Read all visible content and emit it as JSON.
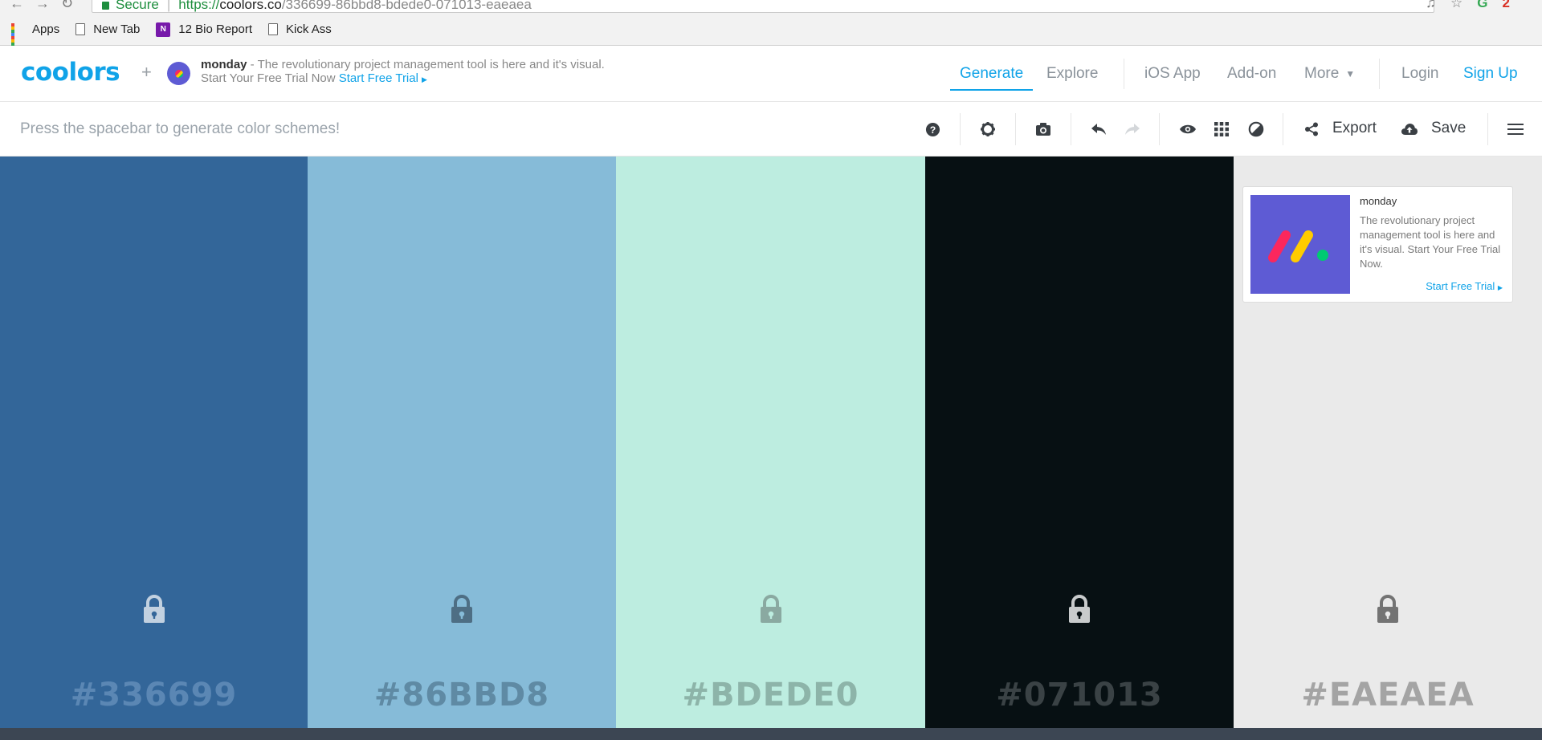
{
  "browser": {
    "secure_label": "Secure",
    "url_protocol": "https://",
    "url_host": "coolors.co",
    "url_path": "/336699-86bbd8-bdede0-071013-eaeaea",
    "bookmarks": [
      {
        "label": "Apps",
        "icon": "apps-grid-icon"
      },
      {
        "label": "New Tab",
        "icon": "page-icon"
      },
      {
        "label": "12 Bio Report",
        "icon": "onenote-icon"
      },
      {
        "label": "Kick Ass",
        "icon": "page-icon"
      }
    ],
    "extension_badge": "2"
  },
  "header": {
    "logo": "coolors",
    "plus": "+",
    "ad_brand": "monday",
    "ad_text": " - The revolutionary project management tool is here and it's visual.",
    "ad_line2": "Start Your Free Trial Now",
    "ad_cta": "Start Free Trial",
    "nav": {
      "generate": "Generate",
      "explore": "Explore",
      "ios": "iOS App",
      "addon": "Add-on",
      "more": "More",
      "login": "Login",
      "signup": "Sign Up"
    },
    "accent_color": "#10a3e8"
  },
  "toolbar": {
    "hint": "Press the spacebar to generate color schemes!",
    "export_label": "Export",
    "save_label": "Save",
    "icons": [
      "help-icon",
      "settings-icon",
      "camera-icon",
      "undo-icon",
      "redo-icon",
      "view-icon",
      "grid-icon",
      "adjust-icon",
      "share-icon",
      "cloud-upload-icon",
      "menu-icon"
    ]
  },
  "palette": {
    "swatches": [
      {
        "hex": "#336699",
        "color": "#336699",
        "hex_text_color": "#5b87b4",
        "lock_color": "#c2d1e0"
      },
      {
        "hex": "#86BBD8",
        "color": "#86bbd8",
        "hex_text_color": "#5f8aa4",
        "lock_color": "#4e6e84"
      },
      {
        "hex": "#BDEDE0",
        "color": "#bdede0",
        "hex_text_color": "#8db4a9",
        "lock_color": "#8aa9a1"
      },
      {
        "hex": "#071013",
        "color": "#071013",
        "hex_text_color": "#3a4245",
        "lock_color": "#c8cbcc"
      },
      {
        "hex": "#EAEAEA",
        "color": "#eaeaea",
        "hex_text_color": "#a4a4a4",
        "lock_color": "#737373"
      }
    ]
  },
  "sponsor_card": {
    "title": "monday",
    "description": "The revolutionary project management tool is here and it's visual. Start Your Free Trial Now.",
    "cta": "Start Free Trial"
  }
}
